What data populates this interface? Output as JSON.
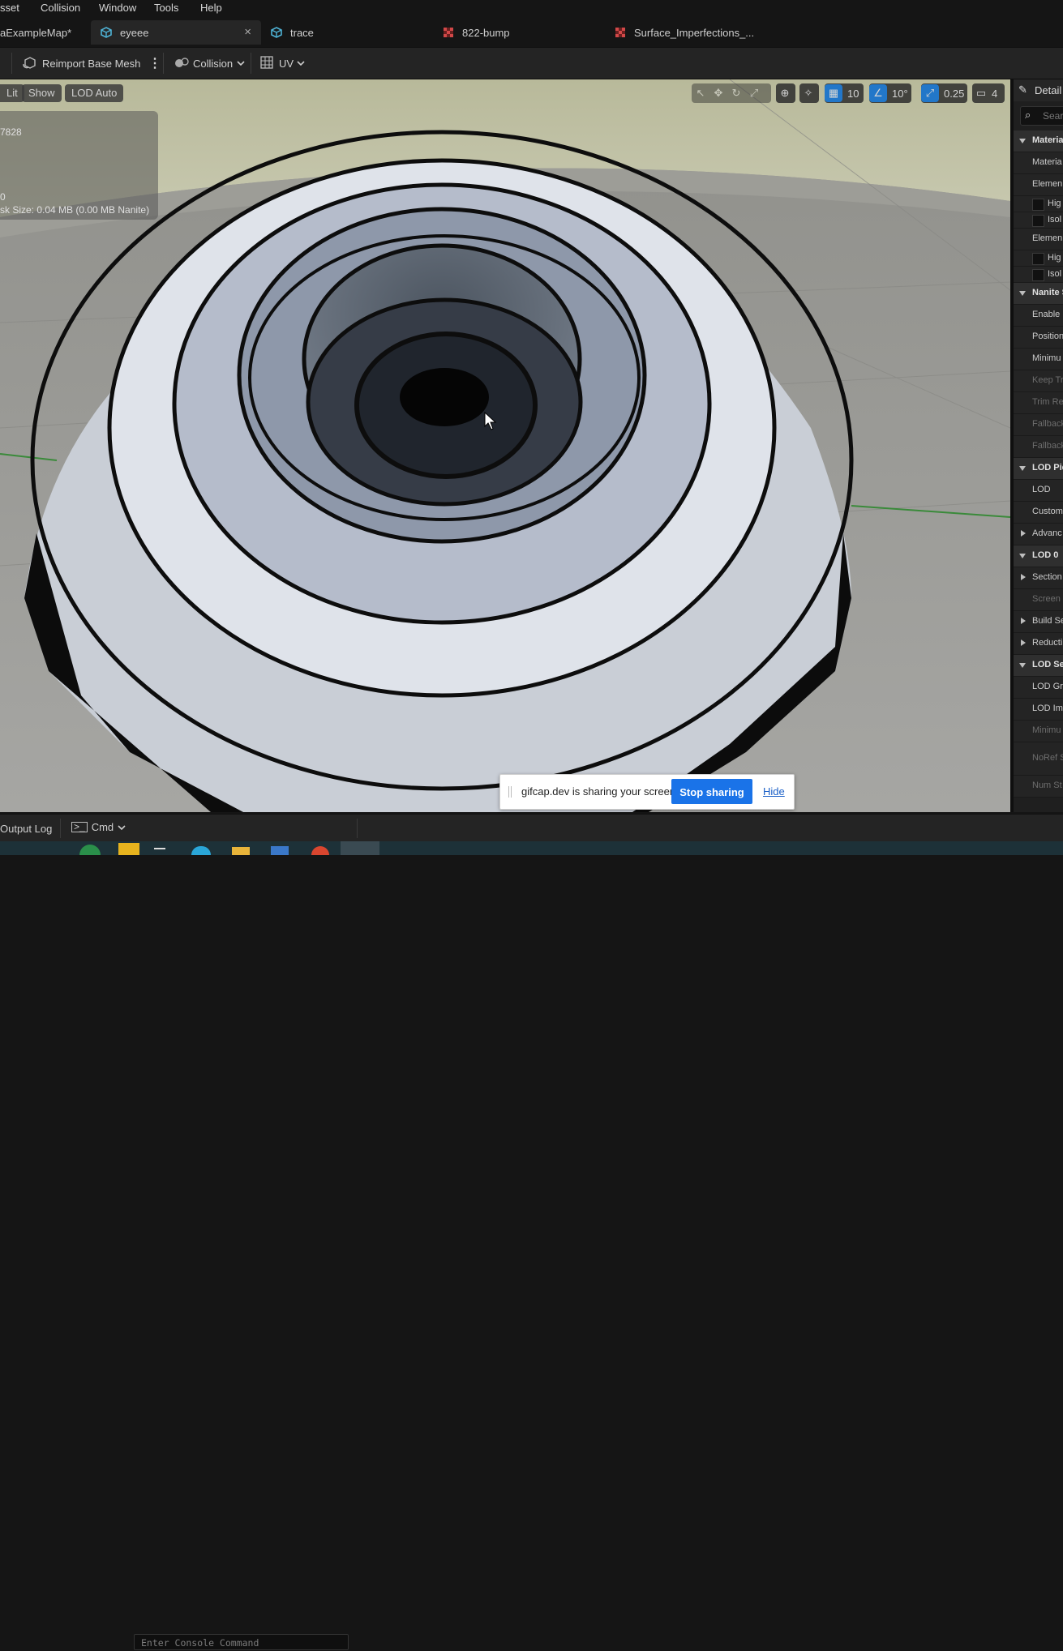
{
  "menu": [
    "sset",
    "Collision",
    "Window",
    "Tools",
    "Help"
  ],
  "tabs": [
    {
      "label": "aExampleMap*"
    },
    {
      "label": "eyeee",
      "close": "×"
    },
    {
      "label": "trace"
    },
    {
      "label": "822-bump"
    },
    {
      "label": "Surface_Imperfections_..."
    }
  ],
  "toolbar": {
    "reimport": "Reimport Base Mesh",
    "collision": "Collision",
    "uv": "UV"
  },
  "viewport": {
    "lit": "Lit",
    "show": "Show",
    "lod": "LOD Auto",
    "stats": [
      "7828",
      "0",
      "sk Size: 0.04 MB (0.00 MB Nanite)"
    ],
    "grid_snap": "10",
    "rot_snap": "10°",
    "scale_snap": "0.25",
    "cam_speed": "4"
  },
  "details": {
    "title": "Detail",
    "search_placeholder": "Sear",
    "rows": [
      {
        "label": "Materia",
        "kind": "cat"
      },
      {
        "label": "Materia",
        "kind": "row"
      },
      {
        "label": "Elemen",
        "kind": "row"
      },
      {
        "label": "Hig",
        "kind": "check"
      },
      {
        "label": "Isol",
        "kind": "check"
      },
      {
        "label": "Elemen",
        "kind": "row"
      },
      {
        "label": "Hig",
        "kind": "check"
      },
      {
        "label": "Isol",
        "kind": "check"
      },
      {
        "label": "Nanite S",
        "kind": "cat"
      },
      {
        "label": "Enable I",
        "kind": "row"
      },
      {
        "label": "Position",
        "kind": "row"
      },
      {
        "label": "Minimu",
        "kind": "row"
      },
      {
        "label": "Keep Tr",
        "kind": "dim"
      },
      {
        "label": "Trim Re",
        "kind": "dim"
      },
      {
        "label": "Fallback",
        "kind": "dim"
      },
      {
        "label": "Fallback",
        "kind": "dim"
      },
      {
        "label": "LOD Pic",
        "kind": "cat"
      },
      {
        "label": "LOD",
        "kind": "row"
      },
      {
        "label": "Custom",
        "kind": "row"
      },
      {
        "label": "Advanc",
        "kind": "sub"
      },
      {
        "label": "LOD 0",
        "kind": "cat"
      },
      {
        "label": "Section",
        "kind": "sub"
      },
      {
        "label": "Screen",
        "kind": "dim"
      },
      {
        "label": "Build Se",
        "kind": "sub"
      },
      {
        "label": "Reducti",
        "kind": "sub"
      },
      {
        "label": "LOD Set",
        "kind": "cat"
      },
      {
        "label": "LOD Gro",
        "kind": "row"
      },
      {
        "label": "LOD Im",
        "kind": "row"
      },
      {
        "label": "Minimu",
        "kind": "dim"
      },
      {
        "label": "NoRef S",
        "kind": "dim"
      },
      {
        "label": "Num St",
        "kind": "dim"
      }
    ]
  },
  "status": {
    "output_log": "Output Log",
    "cmd": "Cmd",
    "console_placeholder": "Enter Console Command"
  },
  "share": {
    "message": "gifcap.dev is sharing your screen.",
    "stop": "Stop sharing",
    "hide": "Hide"
  },
  "colors": {
    "accent": "#2277c9",
    "stop_button": "#1a73e8",
    "panel": "#242424"
  }
}
